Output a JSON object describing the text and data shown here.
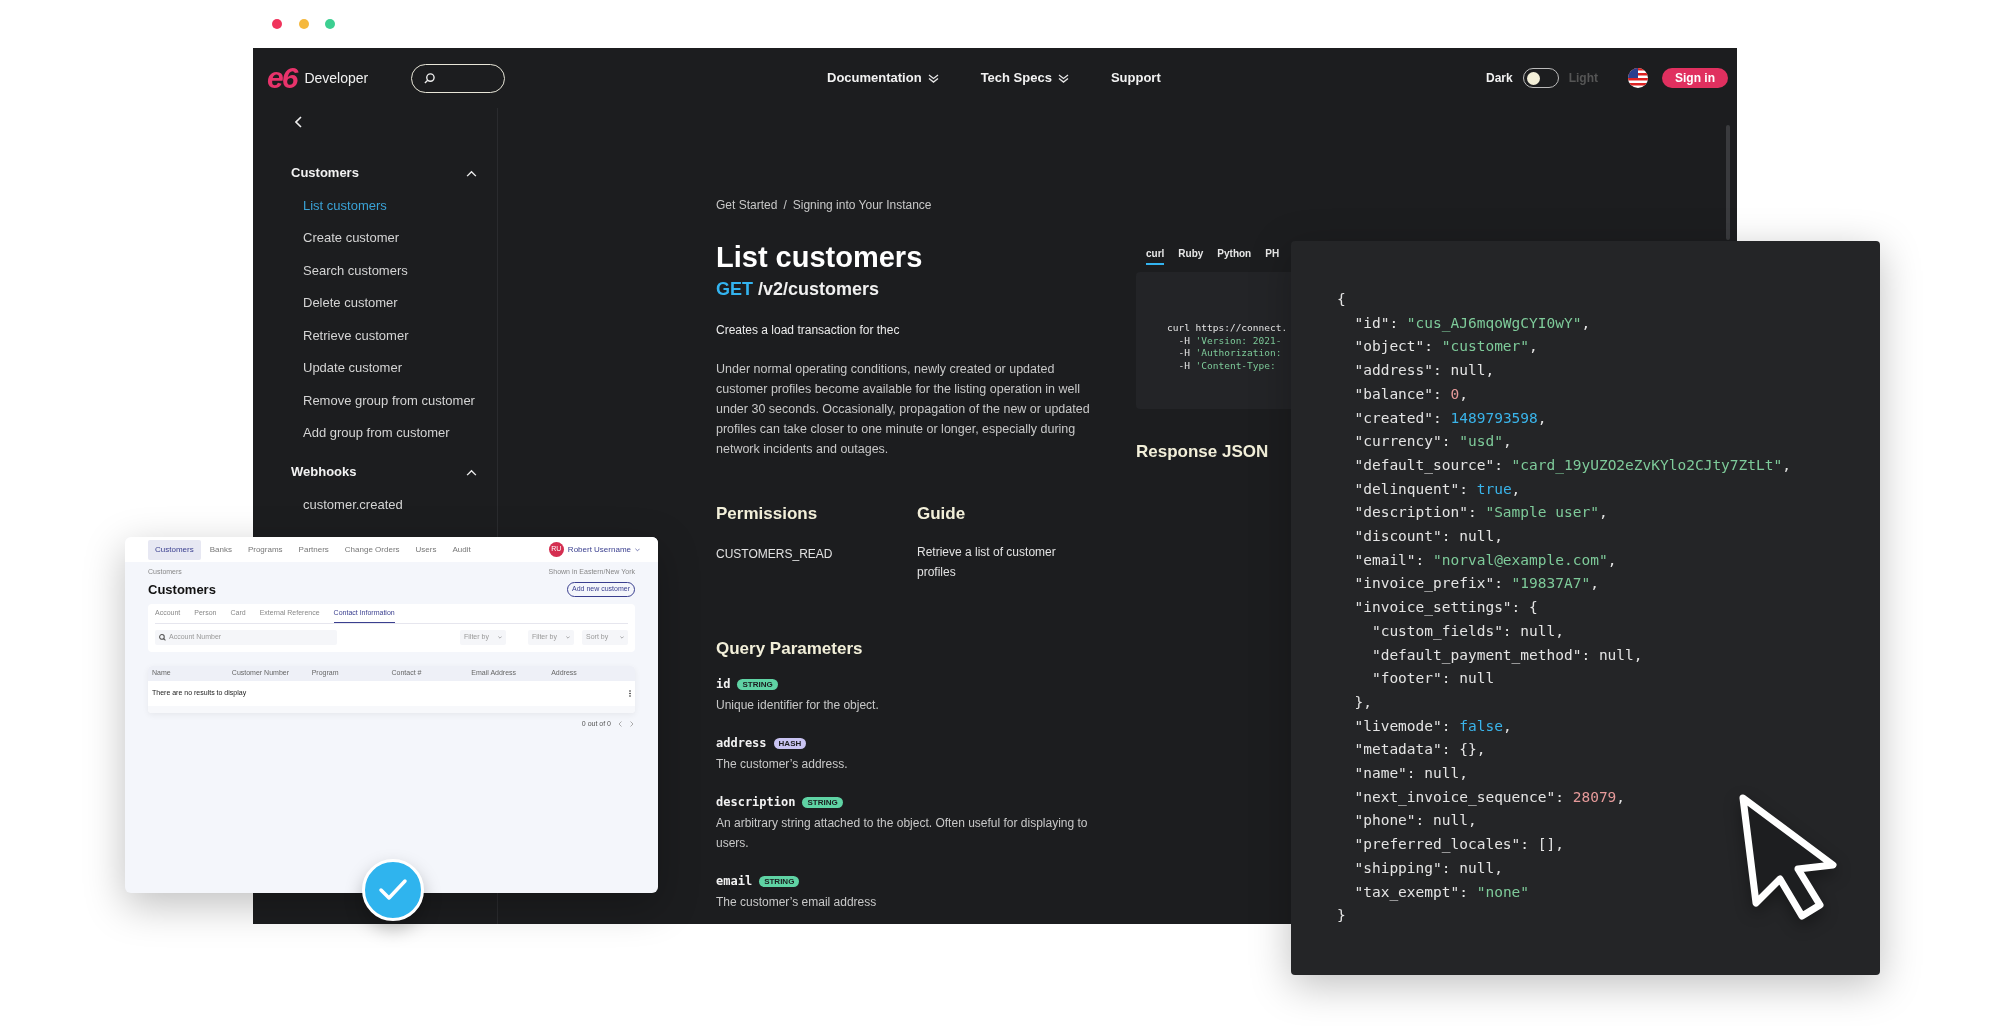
{
  "nav": {
    "logo": "e6",
    "product": "Developer",
    "menu": [
      {
        "label": "Documentation",
        "has_dropdown": true
      },
      {
        "label": "Tech Specs",
        "has_dropdown": true
      },
      {
        "label": "Support",
        "has_dropdown": false
      }
    ],
    "theme": {
      "dark_label": "Dark",
      "light_label": "Light",
      "dark": true
    },
    "sign_in": "Sign in"
  },
  "sidebar": {
    "sections": [
      {
        "title": "Customers",
        "expanded": true,
        "items": [
          {
            "label": "List customers",
            "selected": true
          },
          {
            "label": "Create customer",
            "selected": false
          },
          {
            "label": "Search customers",
            "selected": false
          },
          {
            "label": "Delete customer",
            "selected": false
          },
          {
            "label": "Retrieve customer",
            "selected": false
          },
          {
            "label": "Update customer",
            "selected": false
          },
          {
            "label": "Remove group from customer",
            "selected": false
          },
          {
            "label": "Add group from customer",
            "selected": false
          }
        ]
      },
      {
        "title": "Webhooks",
        "expanded": true,
        "items": [
          {
            "label": "customer.created",
            "selected": false
          }
        ]
      }
    ]
  },
  "content": {
    "breadcrumb": {
      "items": [
        "Get Started",
        "Signing into Your Instance"
      ],
      "separator": "/"
    },
    "title": "List customers",
    "method": "GET",
    "path": "/v2/customers",
    "summary": "Creates a load transaction for thec",
    "description": "Under normal operating conditions, newly created or updated customer profiles become available for the listing operation in well under 30 seconds. Occasionally, propagation of the new or updated profiles can take closer to one minute or longer, especially during network incidents and outages.",
    "permissions": {
      "title": "Permissions",
      "value": "CUSTOMERS_READ"
    },
    "guide": {
      "title": "Guide",
      "text": "Retrieve a list of customer profiles"
    },
    "query_parameters": {
      "title": "Query Parameters",
      "params": [
        {
          "name": "id",
          "type": "STRING",
          "color": "#5fd3a4",
          "description": "Unique identifier for the object."
        },
        {
          "name": "address",
          "type": "HASH",
          "color": "#c9c4f2",
          "description": "The customer’s address."
        },
        {
          "name": "description",
          "type": "STRING",
          "color": "#5fd3a4",
          "description": "An arbitrary string attached to the object. Often useful for displaying to users."
        },
        {
          "name": "email",
          "type": "STRING",
          "color": "#5fd3a4",
          "description": "The customer’s email address"
        }
      ]
    }
  },
  "code_sample": {
    "tabs": [
      {
        "label": "curl",
        "selected": true
      },
      {
        "label": "Ruby",
        "selected": false
      },
      {
        "label": "Python",
        "selected": false
      },
      {
        "label": "PH",
        "selected": false
      }
    ],
    "lines": [
      [
        {
          "kind": "plain",
          "text": "curl https://connect."
        }
      ],
      [
        {
          "kind": "plain",
          "text": "  -H "
        },
        {
          "kind": "string",
          "text": "'Version: 2021-"
        }
      ],
      [
        {
          "kind": "plain",
          "text": "  -H "
        },
        {
          "kind": "string",
          "text": "'Authorization:"
        }
      ],
      [
        {
          "kind": "plain",
          "text": "  -H "
        },
        {
          "kind": "string",
          "text": "'Content-Type:"
        }
      ]
    ],
    "response_title": "Response JSON"
  },
  "json_panel": {
    "lines": [
      [
        {
          "kind": "plain",
          "text": "{"
        }
      ],
      [
        {
          "kind": "plain",
          "text": "  \"id\": "
        },
        {
          "kind": "string",
          "text": "\"cus_AJ6mqoWgCYI0wY\""
        },
        {
          "kind": "plain",
          "text": ","
        }
      ],
      [
        {
          "kind": "plain",
          "text": "  \"object\": "
        },
        {
          "kind": "string",
          "text": "\"customer\""
        },
        {
          "kind": "plain",
          "text": ","
        }
      ],
      [
        {
          "kind": "plain",
          "text": "  \"address\": null,"
        }
      ],
      [
        {
          "kind": "plain",
          "text": "  \"balance\": "
        },
        {
          "kind": "number",
          "text": "0"
        },
        {
          "kind": "plain",
          "text": ","
        }
      ],
      [
        {
          "kind": "plain",
          "text": "  \"created\": "
        },
        {
          "kind": "literal",
          "text": "1489793598"
        },
        {
          "kind": "plain",
          "text": ","
        }
      ],
      [
        {
          "kind": "plain",
          "text": "  \"currency\": "
        },
        {
          "kind": "string",
          "text": "\"usd\""
        },
        {
          "kind": "plain",
          "text": ","
        }
      ],
      [
        {
          "kind": "plain",
          "text": "  \"default_source\": "
        },
        {
          "kind": "string",
          "text": "\"card_19yUZO2eZvKYlo2CJty7ZtLt\""
        },
        {
          "kind": "plain",
          "text": ","
        }
      ],
      [
        {
          "kind": "plain",
          "text": "  \"delinquent\": "
        },
        {
          "kind": "literal",
          "text": "true"
        },
        {
          "kind": "plain",
          "text": ","
        }
      ],
      [
        {
          "kind": "plain",
          "text": "  \"description\": "
        },
        {
          "kind": "string",
          "text": "\"Sample user\""
        },
        {
          "kind": "plain",
          "text": ","
        }
      ],
      [
        {
          "kind": "plain",
          "text": "  \"discount\": null,"
        }
      ],
      [
        {
          "kind": "plain",
          "text": "  \"email\": "
        },
        {
          "kind": "string",
          "text": "\"norval@example.com\""
        },
        {
          "kind": "plain",
          "text": ","
        }
      ],
      [
        {
          "kind": "plain",
          "text": "  \"invoice_prefix\": "
        },
        {
          "kind": "string",
          "text": "\"19837A7\""
        },
        {
          "kind": "plain",
          "text": ","
        }
      ],
      [
        {
          "kind": "plain",
          "text": "  \"invoice_settings\": {"
        }
      ],
      [
        {
          "kind": "plain",
          "text": "    \"custom_fields\": null,"
        }
      ],
      [
        {
          "kind": "plain",
          "text": "    \"default_payment_method\": null,"
        }
      ],
      [
        {
          "kind": "plain",
          "text": "    \"footer\": null"
        }
      ],
      [
        {
          "kind": "plain",
          "text": "  },"
        }
      ],
      [
        {
          "kind": "plain",
          "text": "  \"livemode\": "
        },
        {
          "kind": "literal",
          "text": "false"
        },
        {
          "kind": "plain",
          "text": ","
        }
      ],
      [
        {
          "kind": "plain",
          "text": "  \"metadata\": {},"
        }
      ],
      [
        {
          "kind": "plain",
          "text": "  \"name\": null,"
        }
      ],
      [
        {
          "kind": "plain",
          "text": "  \"next_invoice_sequence\": "
        },
        {
          "kind": "number",
          "text": "28079"
        },
        {
          "kind": "plain",
          "text": ","
        }
      ],
      [
        {
          "kind": "plain",
          "text": "  \"phone\": null,"
        }
      ],
      [
        {
          "kind": "plain",
          "text": "  \"preferred_locales\": [],"
        }
      ],
      [
        {
          "kind": "plain",
          "text": "  \"shipping\": null,"
        }
      ],
      [
        {
          "kind": "plain",
          "text": "  \"tax_exempt\": "
        },
        {
          "kind": "string",
          "text": "\"none\""
        }
      ],
      [
        {
          "kind": "plain",
          "text": "}"
        }
      ]
    ]
  },
  "customers_window": {
    "nav": [
      {
        "label": "Customers",
        "selected": true
      },
      {
        "label": "Banks",
        "selected": false
      },
      {
        "label": "Programs",
        "selected": false
      },
      {
        "label": "Partners",
        "selected": false
      },
      {
        "label": "Change Orders",
        "selected": false
      },
      {
        "label": "Users",
        "selected": false
      },
      {
        "label": "Audit",
        "selected": false
      }
    ],
    "user": {
      "initials": "RU",
      "name": "Robert Username"
    },
    "breadcrumb": "Customers",
    "timezone": "Shown in Eastern/New York",
    "title": "Customers",
    "add_button": "Add new customer",
    "tabs": [
      {
        "label": "Account",
        "selected": false
      },
      {
        "label": "Person",
        "selected": false
      },
      {
        "label": "Card",
        "selected": false
      },
      {
        "label": "External Reference",
        "selected": false
      },
      {
        "label": "Contact Information",
        "selected": true
      }
    ],
    "search": {
      "placeholder": "Account Number"
    },
    "filters": [
      "Filter by",
      "Filter by",
      "Sort by"
    ],
    "table": {
      "columns": [
        "Name",
        "Customer Number",
        "Program",
        "Contact #",
        "Email Address",
        "Address"
      ],
      "empty_message": "There are no results to display"
    },
    "pagination": "0 out of 0"
  }
}
